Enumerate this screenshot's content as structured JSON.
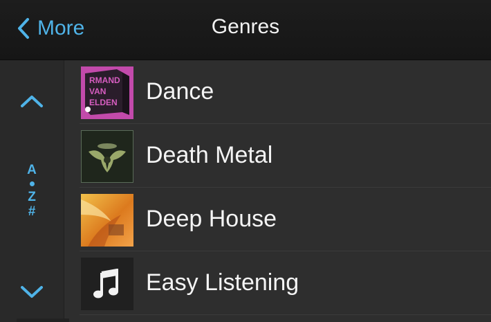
{
  "header": {
    "back_label": "More",
    "title": "Genres",
    "accent_color": "#4fb3e8"
  },
  "index_bar": {
    "up_icon": "chevron-up-icon",
    "letters": [
      "A",
      "Z",
      "#"
    ],
    "down_icon": "chevron-down-icon"
  },
  "genres": [
    {
      "label": "Dance",
      "artwork": "album-art-dance"
    },
    {
      "label": "Death Metal",
      "artwork": "album-art-death-metal"
    },
    {
      "label": "Deep House",
      "artwork": "album-art-deep-house"
    },
    {
      "label": "Easy Listening",
      "artwork": "music-note-icon"
    }
  ],
  "album_art_text": {
    "dance_top": "RMAND",
    "dance_mid": "VAN",
    "dance_bottom": "ELDEN"
  }
}
